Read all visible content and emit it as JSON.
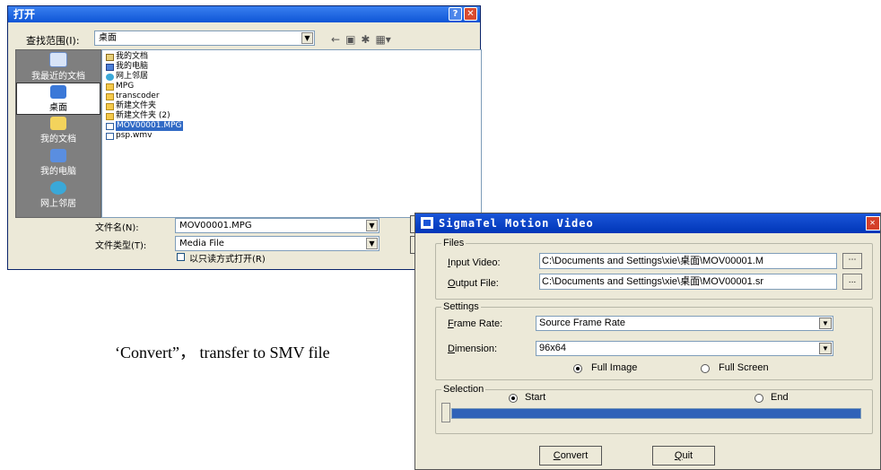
{
  "open_dialog": {
    "title": "打开",
    "lookin_label": "查找范围(I):",
    "lookin_value": "桌面",
    "places": [
      {
        "label": "我最近的文档"
      },
      {
        "label": "桌面"
      },
      {
        "label": "我的文档"
      },
      {
        "label": "我的电脑"
      },
      {
        "label": "网上邻居"
      }
    ],
    "files": [
      {
        "name": "我的文档",
        "icon": "documents-folder-icon"
      },
      {
        "name": "我的电脑",
        "icon": "computer-icon"
      },
      {
        "name": "网上邻居",
        "icon": "network-icon"
      },
      {
        "name": "MPG",
        "icon": "folder-icon"
      },
      {
        "name": "transcoder",
        "icon": "folder-icon"
      },
      {
        "name": "新建文件夹",
        "icon": "folder-icon"
      },
      {
        "name": "新建文件夹 (2)",
        "icon": "folder-icon"
      },
      {
        "name": "MOV00001.MPG",
        "icon": "media-file-icon"
      },
      {
        "name": "psp.wmv",
        "icon": "media-file-icon"
      }
    ],
    "filename_label": "文件名(N):",
    "filename_value": "MOV00001.MPG",
    "filetype_label": "文件类型(T):",
    "filetype_value": "Media File",
    "readonly_label": "以只读方式打开(R)"
  },
  "smv": {
    "title": "SigmaTel Motion Video",
    "files_group": "Files",
    "input_label_u": "I",
    "input_label_rest": "nput Video:",
    "input_value": "C:\\Documents and Settings\\xie\\桌面\\MOV00001.M",
    "output_label_u": "O",
    "output_label_rest": "utput File:",
    "output_value": "C:\\Documents and Settings\\xie\\桌面\\MOV00001.sr",
    "browse_label": "...",
    "settings_group": "Settings",
    "frame_rate_label_u": "F",
    "frame_rate_label_rest": "rame Rate:",
    "frame_rate_value": "Source Frame Rate",
    "dimension_label_u": "D",
    "dimension_label_rest": "imension:",
    "dimension_value": "96x64",
    "full_image": "Full Image",
    "full_screen": "Full Screen",
    "selection_group": "Selection",
    "start": "Start",
    "end": "End",
    "convert_u": "C",
    "convert_rest": "onvert",
    "quit_u": "Q",
    "quit_rest": "uit"
  },
  "caption": "‘Convert”， transfer to SMV file"
}
